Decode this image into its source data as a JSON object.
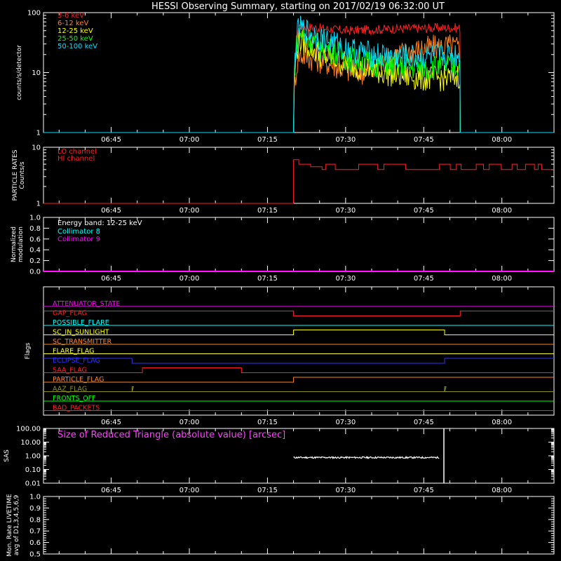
{
  "title": "HESSI Observing Summary, starting on 2017/02/19 06:32:00 UT",
  "time_ticks": [
    "06:45",
    "07:00",
    "07:15",
    "07:30",
    "07:45",
    "08:00"
  ],
  "chart_data": [
    {
      "id": "xray",
      "type": "line",
      "ylabel": "counts/s/detector",
      "yscale": "log",
      "ylim": [
        1,
        100
      ],
      "ytick_labels": [
        "1",
        "10",
        "100"
      ],
      "xlim": [
        "06:32",
        "08:10"
      ],
      "series": [
        {
          "name": "3-6 keV",
          "color": "#ff2020",
          "x": [
            "07:20",
            "07:21",
            "07:25",
            "07:30",
            "07:35",
            "07:40",
            "07:45",
            "07:50",
            "07:52"
          ],
          "y": [
            1,
            60,
            55,
            50,
            52,
            54,
            55,
            56,
            55
          ]
        },
        {
          "name": "6-12 keV",
          "color": "#ff8020",
          "x": [
            "07:20",
            "07:21",
            "07:25",
            "07:30",
            "07:35",
            "07:40",
            "07:45",
            "07:50",
            "07:52"
          ],
          "y": [
            1,
            20,
            16,
            11,
            10,
            20,
            25,
            28,
            25
          ]
        },
        {
          "name": "12-25 keV",
          "color": "#ffff00",
          "x": [
            "07:20",
            "07:21",
            "07:25",
            "07:30",
            "07:35",
            "07:40",
            "07:45",
            "07:50",
            "07:52"
          ],
          "y": [
            1,
            35,
            20,
            14,
            11,
            9,
            8,
            8,
            9
          ]
        },
        {
          "name": "25-50 keV",
          "color": "#00ff00",
          "x": [
            "07:20",
            "07:21",
            "07:25",
            "07:30",
            "07:35",
            "07:40",
            "07:45",
            "07:50",
            "07:52"
          ],
          "y": [
            1,
            45,
            28,
            18,
            14,
            13,
            12,
            13,
            13
          ]
        },
        {
          "name": "50-100 keV",
          "color": "#00e0ff",
          "x": [
            "07:20",
            "07:21",
            "07:25",
            "07:30",
            "07:35",
            "07:40",
            "07:45",
            "07:50",
            "07:52"
          ],
          "y": [
            1,
            55,
            38,
            25,
            20,
            18,
            18,
            19,
            20
          ]
        }
      ]
    },
    {
      "id": "particle",
      "type": "line",
      "ylabel": "PARTICLE RATES Counts/s",
      "yscale": "log",
      "ylim": [
        1,
        10
      ],
      "ytick_labels": [
        "1",
        "10"
      ],
      "series": [
        {
          "name": "LO channel",
          "color": "#ff2020",
          "x": [],
          "y": []
        },
        {
          "name": "HI channel",
          "color": "#ff2020",
          "x": [
            "07:20",
            "07:21",
            "07:23",
            "07:25",
            "07:35",
            "07:45",
            "07:55",
            "08:05",
            "08:10"
          ],
          "y": [
            1,
            6,
            5,
            4,
            4,
            4,
            4,
            4,
            4
          ]
        }
      ]
    },
    {
      "id": "modulation",
      "type": "line",
      "ylabel": "Normalized modulation",
      "ylim": [
        0,
        1
      ],
      "ytick_labels": [
        "0.0",
        "0.2",
        "0.4",
        "0.6",
        "0.8",
        "1.0"
      ],
      "annotation": "Energy band: 12-25 keV",
      "series": [
        {
          "name": "Collimator 8",
          "color": "#00ffff",
          "x": [
            "06:32",
            "08:10"
          ],
          "y": [
            0,
            0
          ]
        },
        {
          "name": "Collimator 9",
          "color": "#ff00ff",
          "x": [
            "06:32",
            "08:10"
          ],
          "y": [
            0,
            0
          ]
        }
      ]
    },
    {
      "id": "flags",
      "type": "line",
      "ylabel": "Flags",
      "flags": [
        {
          "name": "ATTENUATOR_STATE",
          "color": "#ff00ff",
          "segments": [
            [
              "06:32",
              "08:10",
              0
            ]
          ]
        },
        {
          "name": "GAP_FLAG",
          "color": "#ff2020",
          "segments": [
            [
              "06:32",
              "07:20",
              1
            ],
            [
              "07:20",
              "07:52",
              0
            ],
            [
              "07:52",
              "08:10",
              1
            ]
          ]
        },
        {
          "name": "POSSIBLE_FLARE",
          "color": "#00ffff",
          "segments": [
            [
              "06:32",
              "08:10",
              0
            ]
          ]
        },
        {
          "name": "SC_IN_SUNLIGHT",
          "color": "#ffff00",
          "segments": [
            [
              "06:32",
              "07:20",
              0
            ],
            [
              "07:20",
              "07:49",
              1
            ],
            [
              "07:49",
              "08:10",
              0
            ]
          ]
        },
        {
          "name": "SC_TRANSMITTER",
          "color": "#ff8020",
          "segments": [
            [
              "06:32",
              "08:10",
              0
            ]
          ]
        },
        {
          "name": "FLARE_FLAG",
          "color": "#ffff40",
          "segments": [
            [
              "06:32",
              "08:10",
              0
            ]
          ]
        },
        {
          "name": "ECLIPSE_FLAG",
          "color": "#3030ff",
          "segments": [
            [
              "06:32",
              "06:49",
              1
            ],
            [
              "06:49",
              "07:49",
              0
            ],
            [
              "07:49",
              "08:10",
              1
            ]
          ]
        },
        {
          "name": "SAA_FLAG",
          "color": "#ff2020",
          "segments": [
            [
              "06:32",
              "06:51",
              0
            ],
            [
              "06:51",
              "07:10",
              1
            ],
            [
              "07:10",
              "08:10",
              0
            ]
          ]
        },
        {
          "name": "PARTICLE_FLAG",
          "color": "#ff8020",
          "segments": [
            [
              "06:32",
              "07:20",
              0
            ],
            [
              "07:20",
              "08:10",
              1
            ]
          ]
        },
        {
          "name": "AAZ_FLAG",
          "color": "#909020",
          "segments": [
            [
              "06:32",
              "06:49",
              0
            ],
            [
              "06:49",
              "06:49",
              1
            ],
            [
              "06:49",
              "07:49",
              0
            ],
            [
              "07:49",
              "07:49",
              1
            ],
            [
              "07:49",
              "08:10",
              0
            ]
          ]
        },
        {
          "name": "FRONTS_OFF",
          "color": "#00ff00",
          "segments": [
            [
              "06:32",
              "08:10",
              0
            ]
          ]
        },
        {
          "name": "BAD_PACKETS",
          "color": "#ff2020",
          "segments": [
            [
              "06:32",
              "08:10",
              0
            ]
          ]
        }
      ]
    },
    {
      "id": "sas",
      "type": "line",
      "ylabel": "SAS",
      "yscale": "log",
      "ylim": [
        0.01,
        100
      ],
      "ytick_labels": [
        "0.01",
        "0.10",
        "1.00",
        "10.00",
        "100.00"
      ],
      "annotation": "Size of Reduced Triangle (absolute value) [arcsec]",
      "series": [
        {
          "color": "#ffffff",
          "x": [
            "07:20",
            "07:30",
            "07:40",
            "07:48",
            "07:49"
          ],
          "y": [
            0.75,
            0.75,
            0.75,
            0.8,
            0.8
          ]
        }
      ]
    },
    {
      "id": "livetime",
      "type": "line",
      "ylabel": "Mon. Rate LIVETIME avg of D1,3,4,5,6,9",
      "ylim": [
        0.5,
        1
      ],
      "ytick_labels": [
        "0.5",
        "0.6",
        "0.7",
        "0.8",
        "0.9",
        "1.0"
      ],
      "series": []
    }
  ]
}
